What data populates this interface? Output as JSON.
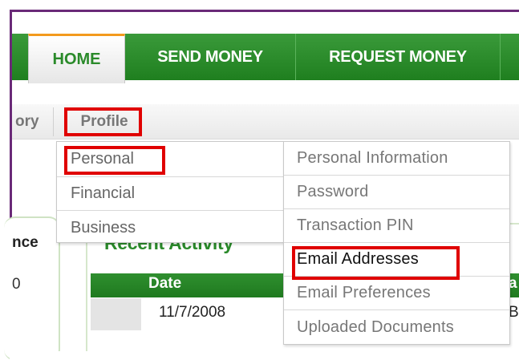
{
  "tabs": {
    "home": "HOME",
    "send_money": "SEND MONEY",
    "request_money": "REQUEST MONEY"
  },
  "subnav": {
    "partial_item": "ory",
    "profile": "Profile"
  },
  "profile_menu": {
    "items": [
      "Personal",
      "Financial",
      "Business"
    ]
  },
  "personal_submenu": {
    "items": [
      "Personal Information",
      "Password",
      "Transaction PIN",
      "Email Addresses",
      "Email Preferences",
      "Uploaded Documents"
    ]
  },
  "balance": {
    "label_partial": "nce",
    "value_partial": "0"
  },
  "recent_activity": {
    "title": "Recent Activity",
    "columns": [
      "Date"
    ],
    "column_edge_partial": "a",
    "rows": [
      {
        "date": "11/7/2008",
        "edge_partial": "B"
      }
    ]
  },
  "highlight_color": "#e00000",
  "brand_green": "#2a8a2a",
  "frame_color": "#6a2a78"
}
